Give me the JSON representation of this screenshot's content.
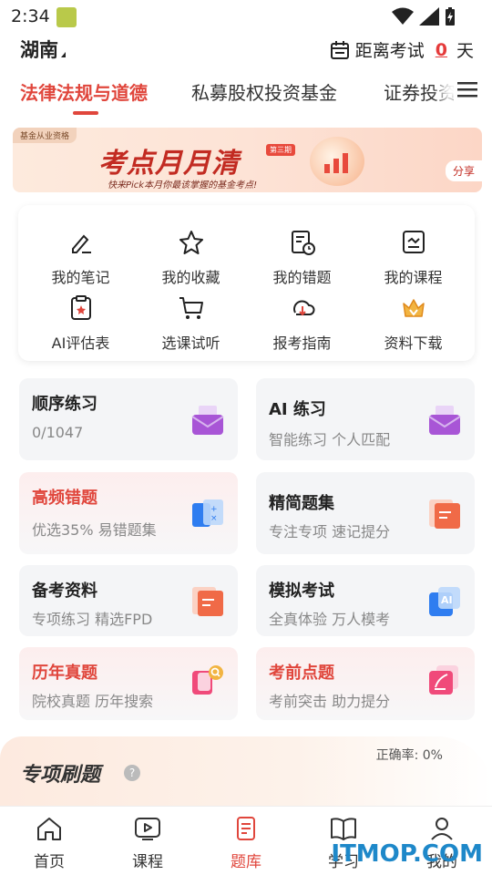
{
  "status_bar": {
    "time": "2:34"
  },
  "header": {
    "region": "湖南",
    "countdown_prefix": "距离考试",
    "days": "0",
    "days_unit": "天"
  },
  "tabs": [
    {
      "label": "法律法规与道德"
    },
    {
      "label": "私募股权投资基金"
    },
    {
      "label": "证券投资"
    }
  ],
  "banner": {
    "tag": "基金从业资格",
    "title": "考点月月清",
    "badge": "第三期",
    "subtitle": "快来Pick本月你最该掌握的基金考点!",
    "share": "分享"
  },
  "quick_links": [
    {
      "label": "我的笔记",
      "icon": "note-edit-icon"
    },
    {
      "label": "我的收藏",
      "icon": "star-icon"
    },
    {
      "label": "我的错题",
      "icon": "wrong-questions-icon"
    },
    {
      "label": "我的课程",
      "icon": "course-icon"
    },
    {
      "label": "AI评估表",
      "icon": "ai-assessment-icon"
    },
    {
      "label": "选课试听",
      "icon": "cart-icon"
    },
    {
      "label": "报考指南",
      "icon": "download-guide-icon"
    },
    {
      "label": "资料下载",
      "icon": "crown-icon"
    }
  ],
  "practice": [
    {
      "title": "顺序练习",
      "subtitle": "0/1047",
      "icon": "envelope-icon"
    },
    {
      "title": "AI 练习",
      "subtitle": "智能练习 个人匹配",
      "icon": "ai-envelope-icon"
    },
    {
      "title": "高频错题",
      "subtitle": "优选35% 易错题集",
      "icon": "calculator-icon"
    },
    {
      "title": "精简题集",
      "subtitle": "专注专项 速记提分",
      "icon": "folder-icon"
    },
    {
      "title": "备考资料",
      "subtitle": "专项练习 精选FPD",
      "icon": "document-icon"
    },
    {
      "title": "模拟考试",
      "subtitle": "全真体验 万人模考",
      "icon": "ai-exam-icon"
    },
    {
      "title": "历年真题",
      "subtitle": "院校真题 历年搜索",
      "icon": "search-paper-icon"
    },
    {
      "title": "考前点题",
      "subtitle": "考前突击 助力提分",
      "icon": "pen-paper-icon"
    }
  ],
  "special": {
    "title": "专项刷题",
    "accuracy": "正确率: 0%"
  },
  "bottom_nav": [
    {
      "label": "首页",
      "icon": "home-icon"
    },
    {
      "label": "课程",
      "icon": "play-icon"
    },
    {
      "label": "题库",
      "icon": "question-bank-icon"
    },
    {
      "label": "学习",
      "icon": "book-icon"
    },
    {
      "label": "我的",
      "icon": "profile-icon"
    }
  ],
  "watermark": "ITMOP.COM",
  "colors": {
    "accent": "#e0463c",
    "brand_red": "#c22b22",
    "icon_purple": "#a855d6"
  }
}
